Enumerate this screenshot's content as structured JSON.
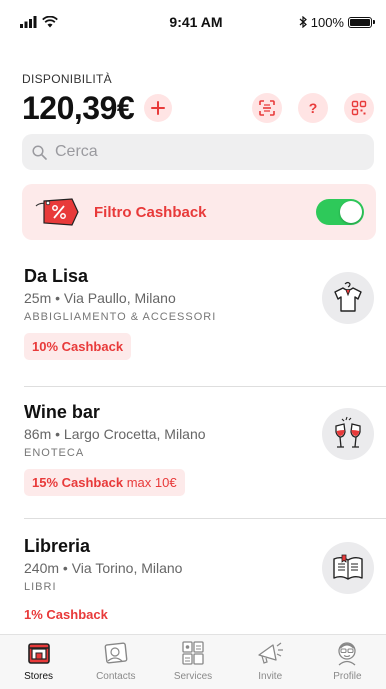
{
  "status_bar": {
    "time": "9:41 AM",
    "battery": "100%"
  },
  "header": {
    "availability_label": "DISPONIBILITÀ",
    "balance": "120,39€",
    "help_label": "?"
  },
  "search": {
    "placeholder": "Cerca"
  },
  "cashback_filter": {
    "label": "Filtro Cashback",
    "enabled": true
  },
  "stores": [
    {
      "name": "Da Lisa",
      "meta": "25m • Via Paullo, Milano",
      "category": "ABBIGLIAMENTO & ACCESSORI",
      "cashback": "10% Cashback",
      "cashback_max": "",
      "icon": "tshirt-icon"
    },
    {
      "name": "Wine bar",
      "meta": "86m • Largo Crocetta, Milano",
      "category": "ENOTECA",
      "cashback": "15% Cashback",
      "cashback_max": "max 10€",
      "icon": "wine-glasses-icon"
    },
    {
      "name": "Libreria",
      "meta": "240m • Via Torino, Milano",
      "category": "LIBRI",
      "cashback": "1% Cashback",
      "cashback_max": "",
      "icon": "book-icon"
    }
  ],
  "tabs": [
    {
      "label": "Stores",
      "active": true
    },
    {
      "label": "Contacts",
      "active": false
    },
    {
      "label": "Services",
      "active": false
    },
    {
      "label": "Invite",
      "active": false
    },
    {
      "label": "Profile",
      "active": false
    }
  ],
  "colors": {
    "accent": "#e83a3a",
    "accent_light": "#fdeaea",
    "toggle_on": "#2ec95a"
  }
}
